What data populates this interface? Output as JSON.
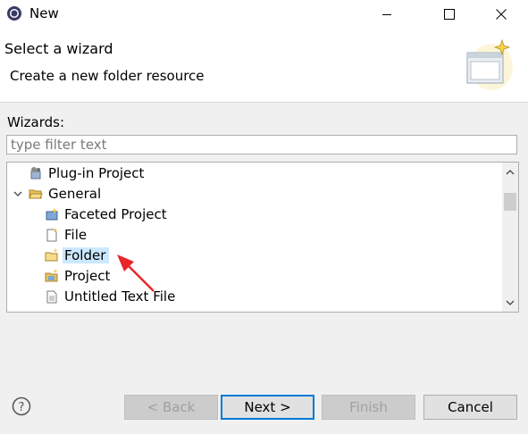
{
  "window": {
    "title": "New"
  },
  "header": {
    "title": "Select a wizard",
    "description": "Create a new folder resource"
  },
  "wizards": {
    "label": "Wizards:",
    "filter_placeholder": "type filter text",
    "items": [
      {
        "label": "Plug-in Project",
        "icon": "plugin-project-icon"
      },
      {
        "label": "General",
        "icon": "folder-open-icon",
        "expanded": true
      },
      {
        "label": "Faceted Project",
        "icon": "faceted-project-icon"
      },
      {
        "label": "File",
        "icon": "new-file-icon"
      },
      {
        "label": "Folder",
        "icon": "new-folder-icon",
        "selected": true
      },
      {
        "label": "Project",
        "icon": "new-project-icon"
      },
      {
        "label": "Untitled Text File",
        "icon": "text-file-icon"
      }
    ]
  },
  "buttons": {
    "back": "< Back",
    "next": "Next >",
    "finish": "Finish",
    "cancel": "Cancel"
  },
  "colors": {
    "selection": "#cce8ff",
    "annotation_arrow": "#e8262a",
    "default_button_border": "#0078d7"
  }
}
